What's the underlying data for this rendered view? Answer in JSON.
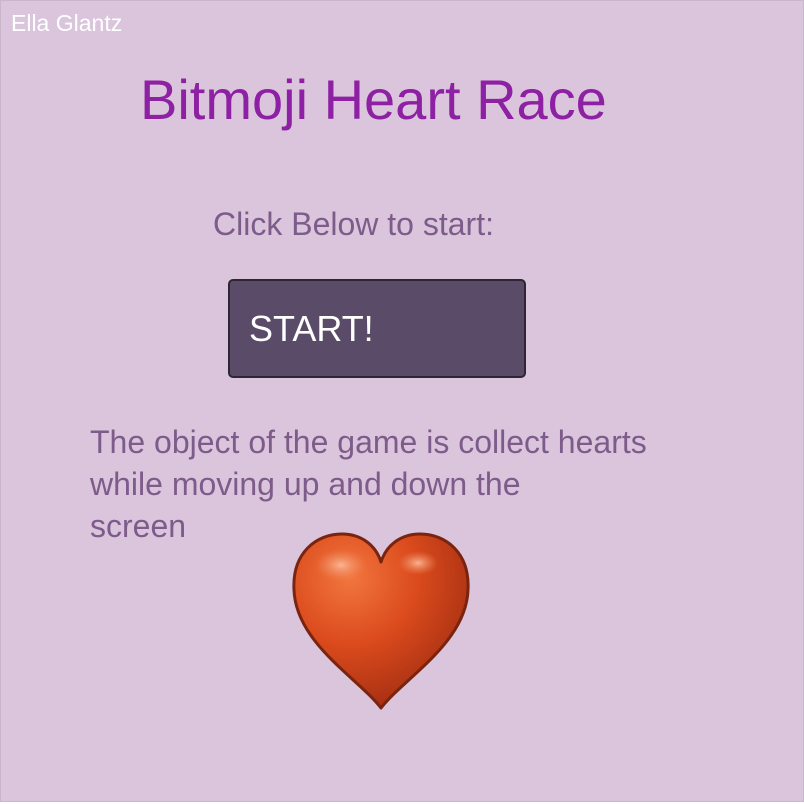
{
  "app": {
    "author": "Ella Glantz",
    "title": "Bitmoji Heart Race",
    "prompt": "Click Below to start:",
    "start_label": "START!",
    "description_lines": [
      "The object of the game is collect hearts",
      "while moving up and down the",
      "screen"
    ]
  },
  "colors": {
    "background": "#dac5dc",
    "title": "#8e20a3",
    "text": "#7d5b8a",
    "button": "#5a4b68",
    "heart": "#d9481c"
  },
  "icons": {
    "heart": "heart-icon"
  }
}
